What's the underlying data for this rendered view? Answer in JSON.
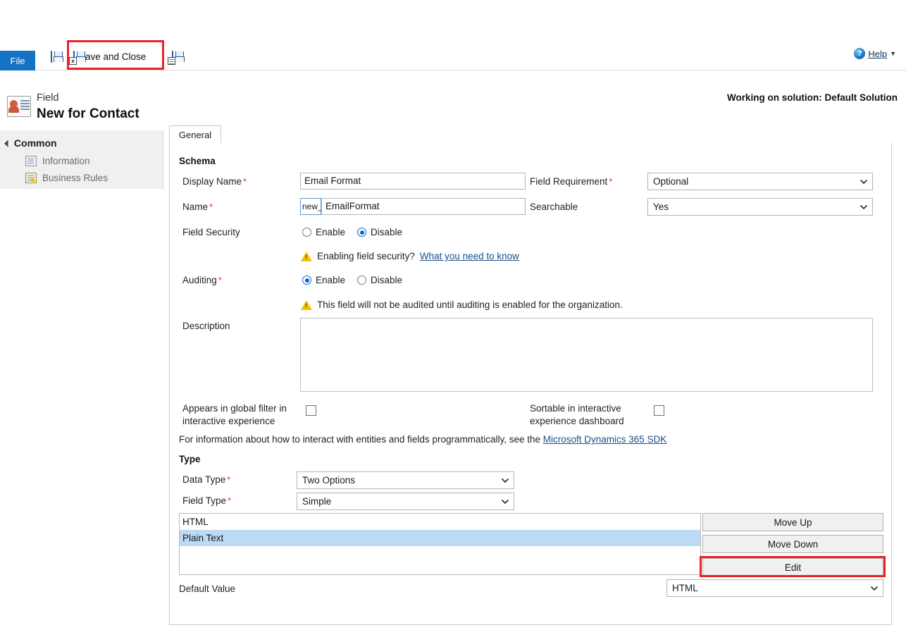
{
  "ribbon": {
    "file_tab": "File",
    "save_tooltip": "Save",
    "save_and_close": "Save and Close",
    "save_as_new_tooltip": "Save as New",
    "help": "Help",
    "help_caret": "▼",
    "help_icon_glyph": "?"
  },
  "header": {
    "entity_kind": "Field",
    "title": "New for Contact",
    "solution_note": "Working on solution: Default Solution"
  },
  "sidebar": {
    "group": "Common",
    "group_arrow": "◢",
    "items": [
      {
        "label": "Information"
      },
      {
        "label": "Business Rules"
      }
    ]
  },
  "tabs": [
    {
      "label": "General",
      "active": true
    }
  ],
  "schema": {
    "heading": "Schema",
    "display_name": {
      "label": "Display Name",
      "required": "*",
      "value": "Email Format"
    },
    "name": {
      "label": "Name",
      "required": "*",
      "prefix": "new_",
      "value": "EmailFormat"
    },
    "field_requirement": {
      "label": "Field Requirement",
      "required": "*",
      "value": "Optional"
    },
    "searchable": {
      "label": "Searchable",
      "value": "Yes"
    },
    "field_security": {
      "label": "Field Security",
      "options": [
        "Enable",
        "Disable"
      ],
      "selected": "Disable"
    },
    "field_security_warning": {
      "text": "Enabling field security?",
      "link": "What you need to know"
    },
    "auditing": {
      "label": "Auditing",
      "required": "*",
      "options": [
        "Enable",
        "Disable"
      ],
      "selected": "Enable"
    },
    "auditing_warning": {
      "text": "This field will not be audited until auditing is enabled for the organization."
    },
    "description": {
      "label": "Description",
      "value": ""
    },
    "global_filter": {
      "label_line1": "Appears in global filter in",
      "label_line2": "interactive experience",
      "checked": false
    },
    "sortable": {
      "label_line1": "Sortable in interactive",
      "label_line2": "experience dashboard",
      "checked": false
    },
    "sdk_note": {
      "text": "For information about how to interact with entities and fields programmatically, see the",
      "link": "Microsoft Dynamics 365 SDK"
    }
  },
  "type": {
    "heading": "Type",
    "data_type": {
      "label": "Data Type",
      "required": "*",
      "value": "Two Options"
    },
    "field_type": {
      "label": "Field Type",
      "required": "*",
      "value": "Simple"
    },
    "options_list": {
      "items": [
        {
          "label": "HTML",
          "selected": false
        },
        {
          "label": "Plain Text",
          "selected": true
        }
      ]
    },
    "buttons": {
      "move_up": "Move Up",
      "move_down": "Move Down",
      "edit": "Edit"
    },
    "default_value": {
      "label": "Default Value",
      "value": "HTML"
    }
  },
  "colors": {
    "file_tab_blue": "#1573c4",
    "highlight_red": "#e8232a",
    "required_red": "#d83b2c",
    "link_blue": "#1a4f8a",
    "list_selection": "#bcd9f5",
    "sidebar_bg": "#f0f0f0"
  }
}
